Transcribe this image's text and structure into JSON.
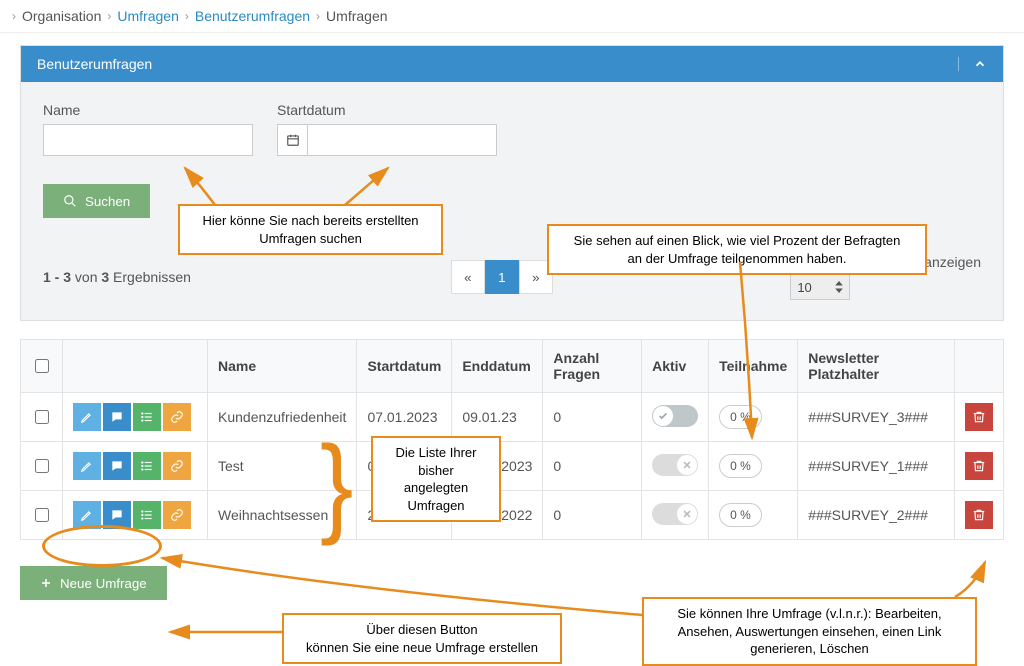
{
  "breadcrumb": {
    "root": "Organisation",
    "umfragen": "Umfragen",
    "benutzer": "Benutzerumfragen",
    "leaf": "Umfragen"
  },
  "panel": {
    "title": "Benutzerumfragen",
    "nameLabel": "Name",
    "startLabel": "Startdatum",
    "searchLabel": "Suchen"
  },
  "results": {
    "text_prefix": "1 - 3",
    "text_mid": " von ",
    "text_count": "3",
    "text_suffix": " Ergebnissen",
    "pageLabel": "Ergebnisse pro Seite anzeigen",
    "pageSize": "10",
    "pages": {
      "prev": "«",
      "one": "1",
      "next": "»"
    }
  },
  "table": {
    "headers": {
      "name": "Name",
      "start": "Startdatum",
      "end": "Enddatum",
      "count": "Anzahl Fragen",
      "active": "Aktiv",
      "part": "Teilnahme",
      "placeholder": "Newsletter Platzhalter"
    },
    "rows": [
      {
        "name": "Kundenzufriedenheit",
        "start": "07.01.2023",
        "end": "09.01.23",
        "count": "0",
        "active": true,
        "pct": "0 %",
        "ph": "###SURVEY_3###"
      },
      {
        "name": "Test",
        "start": "01.01.2023",
        "end": "05.01.2023",
        "count": "0",
        "active": false,
        "pct": "0 %",
        "ph": "###SURVEY_1###"
      },
      {
        "name": "Weihnachtsessen",
        "start": "20.12.2022",
        "end": "23.12.2022",
        "count": "0",
        "active": false,
        "pct": "0 %",
        "ph": "###SURVEY_2###"
      }
    ]
  },
  "newButton": "Neue Umfrage",
  "annotations": {
    "search": "Hier könne Sie nach bereits erstellten\nUmfragen suchen",
    "percent": "Sie sehen auf einen Blick, wie viel Prozent der Befragten\nan der Umfrage teilgenommen haben.",
    "list": "Die Liste Ihrer\nbisher angelegten\nUmfragen",
    "new": "Über diesen Button\nkönnen Sie eine neue Umfrage erstellen",
    "rowactions": "Sie können Ihre Umfrage (v.l.n.r.): Bearbeiten,\nAnsehen, Auswertungen einsehen, einen Link\ngenerieren, Löschen"
  }
}
